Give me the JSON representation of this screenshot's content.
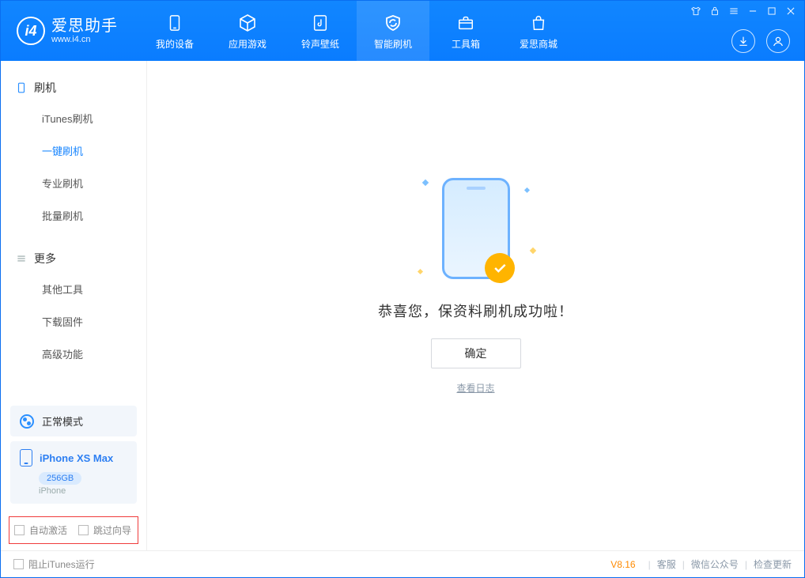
{
  "brand": {
    "cn": "爱思助手",
    "url": "www.i4.cn"
  },
  "nav": {
    "items": [
      {
        "label": "我的设备"
      },
      {
        "label": "应用游戏"
      },
      {
        "label": "铃声壁纸"
      },
      {
        "label": "智能刷机"
      },
      {
        "label": "工具箱"
      },
      {
        "label": "爱思商城"
      }
    ],
    "selected_index": 3
  },
  "sidebar": {
    "sections": {
      "flash": {
        "title": "刷机",
        "items": [
          "iTunes刷机",
          "一键刷机",
          "专业刷机",
          "批量刷机"
        ],
        "active_index": 1
      },
      "more": {
        "title": "更多",
        "items": [
          "其他工具",
          "下载固件",
          "高级功能"
        ]
      }
    },
    "mode": "正常模式",
    "device": {
      "name": "iPhone XS Max",
      "capacity": "256GB",
      "type": "iPhone"
    },
    "options": {
      "auto_activate": "自动激活",
      "skip_guide": "跳过向导"
    }
  },
  "content": {
    "success_text": "恭喜您，保资料刷机成功啦！",
    "ok": "确定",
    "view_log": "查看日志"
  },
  "footer": {
    "block_itunes": "阻止iTunes运行",
    "version": "V8.16",
    "links": [
      "客服",
      "微信公众号",
      "检查更新"
    ]
  }
}
